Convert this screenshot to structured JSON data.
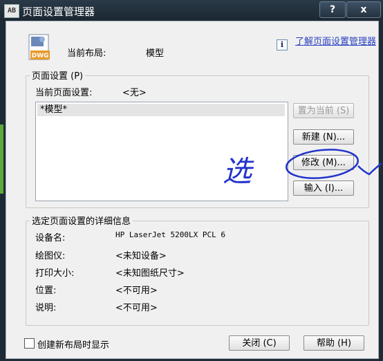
{
  "window": {
    "title": "页面设置管理器",
    "app_icon_text": "AB",
    "help_button": "?",
    "close_button": "x"
  },
  "header": {
    "current_layout_label": "当前布局:",
    "current_layout_value": "模型",
    "help_link": "了解页面设置管理器",
    "dwg_icon_text": "DWG"
  },
  "page_setups": {
    "group_title": "页面设置 (P)",
    "current_label": "当前页面设置:",
    "current_value": "<无>",
    "list_items": [
      "*模型*"
    ],
    "buttons": {
      "set_current": "置为当前 (S)",
      "new": "新建 (N)...",
      "modify": "修改 (M)...",
      "import": "输入 (I)..."
    }
  },
  "details": {
    "group_title": "选定页面设置的详细信息",
    "rows": [
      {
        "label": "设备名:",
        "value": "HP LaserJet 5200LX PCL 6"
      },
      {
        "label": "绘图仪:",
        "value": "<未知设备>"
      },
      {
        "label": "打印大小:",
        "value": "<未知图纸尺寸>"
      },
      {
        "label": "位置:",
        "value": "<不可用>"
      },
      {
        "label": "说明:",
        "value": "<不可用>"
      }
    ]
  },
  "footer": {
    "checkbox_label": "创建新布局时显示",
    "close_button": "关闭 (C)",
    "help_button": "帮助 (H)"
  },
  "annotation": {
    "handwritten_text": "选"
  },
  "colors": {
    "titlebar": "#1b2731",
    "dialog_bg": "#f0f0f0",
    "link": "#2a3fc0",
    "ink": "#2233cc"
  }
}
